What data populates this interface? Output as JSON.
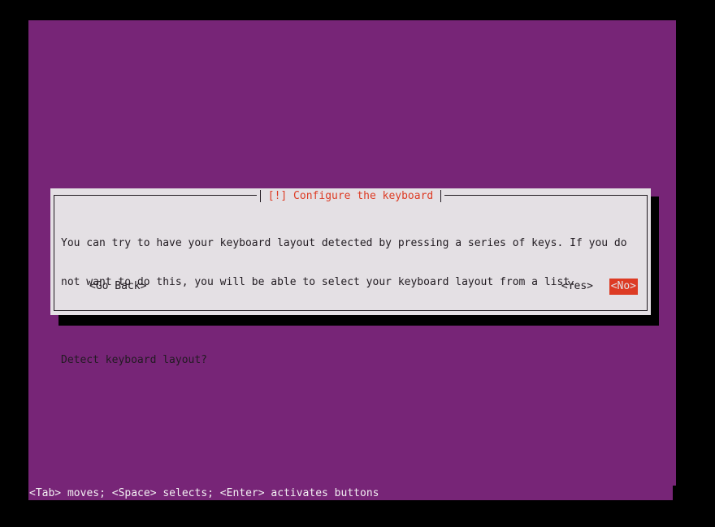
{
  "screen": {
    "background_color": "#000000",
    "terminal_color": "#772577"
  },
  "dialog": {
    "title": "[!] Configure the keyboard",
    "title_color": "#dd3b24",
    "background_color": "#e4e0e4",
    "border_color": "#211b21",
    "body": {
      "paragraph_line_1": "You can try to have your keyboard layout detected by pressing a series of keys. If you do",
      "paragraph_line_2": "not want to do this, you will be able to select your keyboard layout from a list.",
      "question": "Detect keyboard layout?"
    },
    "buttons": {
      "go_back": "<Go Back>",
      "yes": "<Yes>",
      "no": "<No>",
      "selected": "<No>",
      "selected_background": "#dd3b24",
      "selected_text_color": "#e4e0e4"
    }
  },
  "statusbar": {
    "text": "<Tab> moves; <Space> selects; <Enter> activates buttons",
    "text_color": "#f2eff2"
  }
}
